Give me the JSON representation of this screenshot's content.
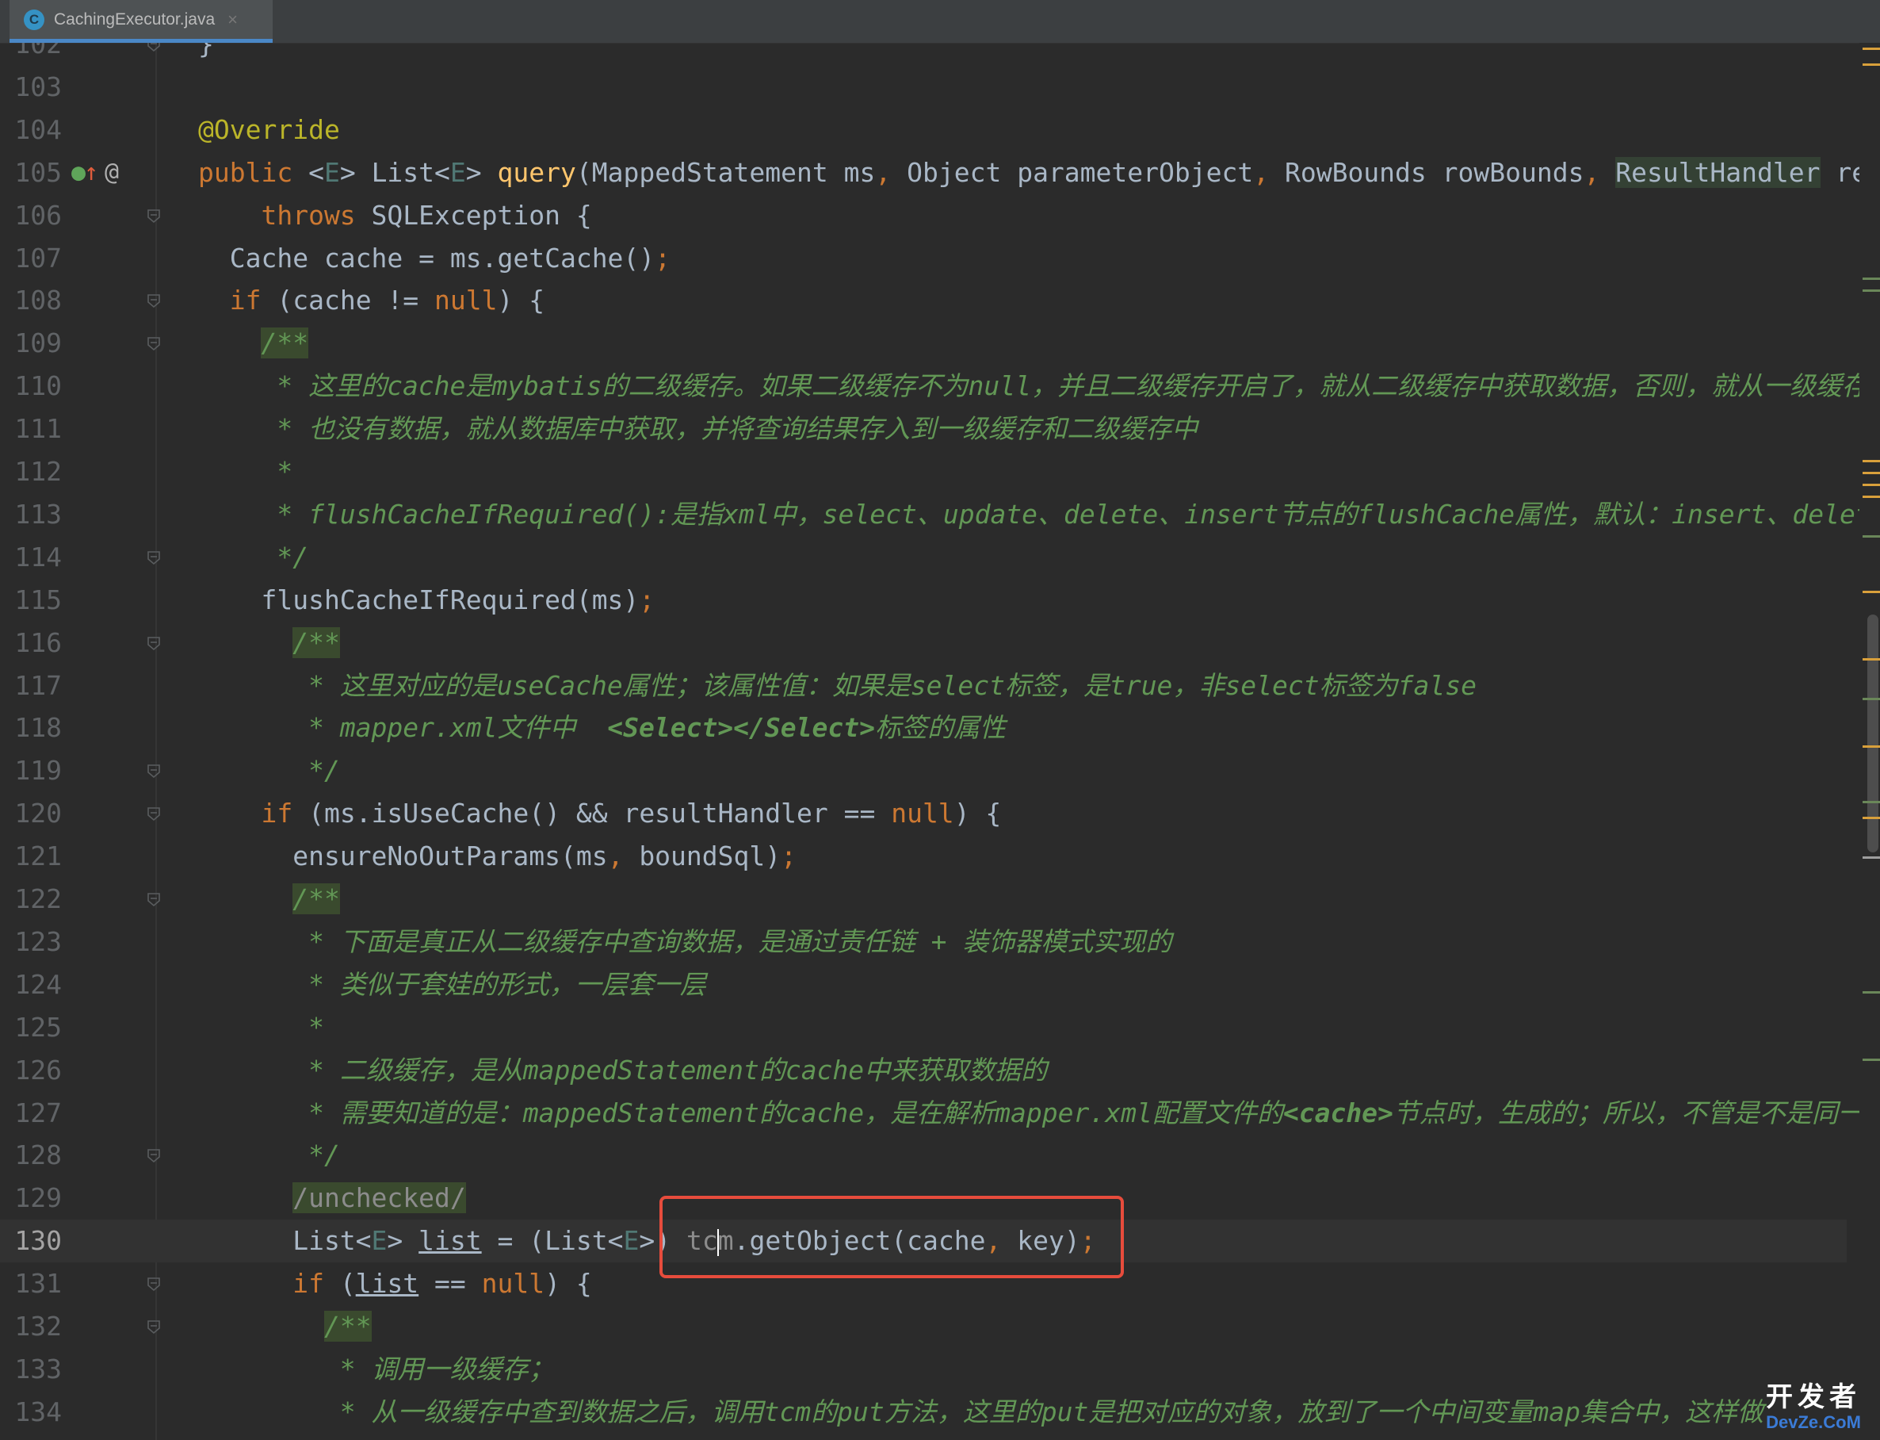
{
  "tab": {
    "filename": "CachingExecutor.java",
    "icon_letter": "C",
    "close": "×"
  },
  "lines": [
    {
      "n": "102",
      "code": [
        {
          "t": "}",
          "c": ""
        }
      ]
    },
    {
      "n": "103",
      "code": []
    },
    {
      "n": "104",
      "code": [
        {
          "t": "@Override",
          "c": "ann"
        }
      ]
    },
    {
      "n": "105",
      "code": [
        {
          "t": "public ",
          "c": "kw"
        },
        {
          "t": "<",
          "c": ""
        },
        {
          "t": "E",
          "c": "tp"
        },
        {
          "t": "> List<",
          "c": ""
        },
        {
          "t": "E",
          "c": "tp"
        },
        {
          "t": "> ",
          "c": ""
        },
        {
          "t": "query",
          "c": "fn"
        },
        {
          "t": "(MappedStatement ms",
          "c": ""
        },
        {
          "t": ", ",
          "c": "kw"
        },
        {
          "t": "Object parameterObject",
          "c": ""
        },
        {
          "t": ", ",
          "c": "kw"
        },
        {
          "t": "RowBounds rowBounds",
          "c": ""
        },
        {
          "t": ", ",
          "c": "kw"
        },
        {
          "t": "ResultHandler",
          "c": "hl"
        },
        {
          "t": " re",
          "c": ""
        }
      ]
    },
    {
      "n": "106",
      "code": [
        {
          "t": "    throws ",
          "c": "kw"
        },
        {
          "t": "SQLException {",
          "c": ""
        }
      ]
    },
    {
      "n": "107",
      "code": [
        {
          "t": "  Cache cache = ms.getCache()",
          "c": ""
        },
        {
          "t": ";",
          "c": "kw"
        }
      ]
    },
    {
      "n": "108",
      "code": [
        {
          "t": "  ",
          "c": ""
        },
        {
          "t": "if ",
          "c": "kw"
        },
        {
          "t": "(cache != ",
          "c": ""
        },
        {
          "t": "null",
          "c": "kw"
        },
        {
          "t": ") {",
          "c": ""
        }
      ]
    },
    {
      "n": "109",
      "code": [
        {
          "t": "    ",
          "c": ""
        },
        {
          "t": "/**",
          "c": "doc dochl"
        }
      ]
    },
    {
      "n": "110",
      "code": [
        {
          "t": "     * 这里的cache是mybatis的二级缓存。如果二级缓存不为null，并且二级缓存开启了，就从二级缓存中获取数据，否则，就从一级缓存中取",
          "c": "doc"
        }
      ]
    },
    {
      "n": "111",
      "code": [
        {
          "t": "     * 也没有数据，就从数据库中获取，并将查询结果存入到一级缓存和二级缓存中",
          "c": "doc"
        }
      ]
    },
    {
      "n": "112",
      "code": [
        {
          "t": "     *",
          "c": "doc"
        }
      ]
    },
    {
      "n": "113",
      "code": [
        {
          "t": "     * flushCacheIfRequired():是指xml中，select、update、delete、insert节点的flushCache属性，默认：insert、delete",
          "c": "doc"
        }
      ]
    },
    {
      "n": "114",
      "code": [
        {
          "t": "     */",
          "c": "doc"
        }
      ]
    },
    {
      "n": "115",
      "code": [
        {
          "t": "    flushCacheIfRequired(ms)",
          "c": ""
        },
        {
          "t": ";",
          "c": "kw"
        }
      ]
    },
    {
      "n": "116",
      "code": [
        {
          "t": "      ",
          "c": ""
        },
        {
          "t": "/**",
          "c": "doc dochl"
        }
      ]
    },
    {
      "n": "117",
      "code": [
        {
          "t": "       * 这里对应的是useCache属性；该属性值：如果是select标签，是true，非select标签为false",
          "c": "doc"
        }
      ]
    },
    {
      "n": "118",
      "code": [
        {
          "t": "       * mapper.xml文件中  ",
          "c": "doc"
        },
        {
          "t": "<Select></Select>",
          "c": "docbold"
        },
        {
          "t": "标签的属性",
          "c": "doc"
        }
      ]
    },
    {
      "n": "119",
      "code": [
        {
          "t": "       */",
          "c": "doc"
        }
      ]
    },
    {
      "n": "120",
      "code": [
        {
          "t": "    ",
          "c": ""
        },
        {
          "t": "if ",
          "c": "kw"
        },
        {
          "t": "(ms.isUseCache() && resultHandler == ",
          "c": ""
        },
        {
          "t": "null",
          "c": "kw"
        },
        {
          "t": ") {",
          "c": ""
        }
      ]
    },
    {
      "n": "121",
      "code": [
        {
          "t": "      ensureNoOutParams(ms",
          "c": ""
        },
        {
          "t": ", ",
          "c": "kw"
        },
        {
          "t": "boundSql)",
          "c": ""
        },
        {
          "t": ";",
          "c": "kw"
        }
      ]
    },
    {
      "n": "122",
      "code": [
        {
          "t": "      ",
          "c": ""
        },
        {
          "t": "/**",
          "c": "doc dochl"
        }
      ]
    },
    {
      "n": "123",
      "code": [
        {
          "t": "       * 下面是真正从二级缓存中查询数据，是通过责任链 + 装饰器模式实现的",
          "c": "doc"
        }
      ]
    },
    {
      "n": "124",
      "code": [
        {
          "t": "       * 类似于套娃的形式，一层套一层",
          "c": "doc"
        }
      ]
    },
    {
      "n": "125",
      "code": [
        {
          "t": "       *",
          "c": "doc"
        }
      ]
    },
    {
      "n": "126",
      "code": [
        {
          "t": "       * 二级缓存，是从mappedStatement的cache中来获取数据的",
          "c": "doc"
        }
      ]
    },
    {
      "n": "127",
      "code": [
        {
          "t": "       * 需要知道的是：mappedStatement的cache，是在解析mapper.xml配置文件的",
          "c": "doc"
        },
        {
          "t": "<cache>",
          "c": "docbold"
        },
        {
          "t": "节点时，生成的；所以，不管是不是同一个s",
          "c": "doc"
        }
      ]
    },
    {
      "n": "128",
      "code": [
        {
          "t": "       */",
          "c": "doc"
        }
      ]
    },
    {
      "n": "129",
      "code": [
        {
          "t": "      ",
          "c": ""
        },
        {
          "t": "/unchecked/",
          "c": "dim dochl"
        }
      ]
    },
    {
      "n": "130",
      "code": [
        {
          "t": "      List<",
          "c": ""
        },
        {
          "t": "E",
          "c": "tp"
        },
        {
          "t": "> ",
          "c": ""
        },
        {
          "t": "list",
          "c": "ul"
        },
        {
          "t": " = (List<",
          "c": ""
        },
        {
          "t": "E",
          "c": "tp"
        },
        {
          "t": ">) ",
          "c": ""
        },
        {
          "t": "tc",
          "c": "dim"
        },
        {
          "t": "",
          "c": "caret"
        },
        {
          "t": "m",
          "c": "dim"
        },
        {
          "t": ".getObject(cache",
          "c": ""
        },
        {
          "t": ", ",
          "c": "kw"
        },
        {
          "t": "key)",
          "c": ""
        },
        {
          "t": ";",
          "c": "kw"
        }
      ]
    },
    {
      "n": "131",
      "code": [
        {
          "t": "      ",
          "c": ""
        },
        {
          "t": "if ",
          "c": "kw"
        },
        {
          "t": "(",
          "c": ""
        },
        {
          "t": "list",
          "c": "ul"
        },
        {
          "t": " == ",
          "c": ""
        },
        {
          "t": "null",
          "c": "kw"
        },
        {
          "t": ") {",
          "c": ""
        }
      ]
    },
    {
      "n": "132",
      "code": [
        {
          "t": "        ",
          "c": ""
        },
        {
          "t": "/**",
          "c": "doc dochl"
        }
      ]
    },
    {
      "n": "133",
      "code": [
        {
          "t": "         * 调用一级缓存；",
          "c": "doc"
        }
      ]
    },
    {
      "n": "134",
      "code": [
        {
          "t": "         * 从一级缓存中查到数据之后，调用tcm的put方法，这里的put是把对应的对象，放到了一个中间变量map集合中，这样做",
          "c": "doc"
        }
      ]
    }
  ],
  "watermark": {
    "top": "开发者",
    "bottom": "DevZe.CoM"
  },
  "colors": {
    "keyword": "#cc7832",
    "annotation": "#bbb529",
    "method": "#ffc66d",
    "doc": "#629755",
    "highlight_box": "#e74c3c"
  }
}
